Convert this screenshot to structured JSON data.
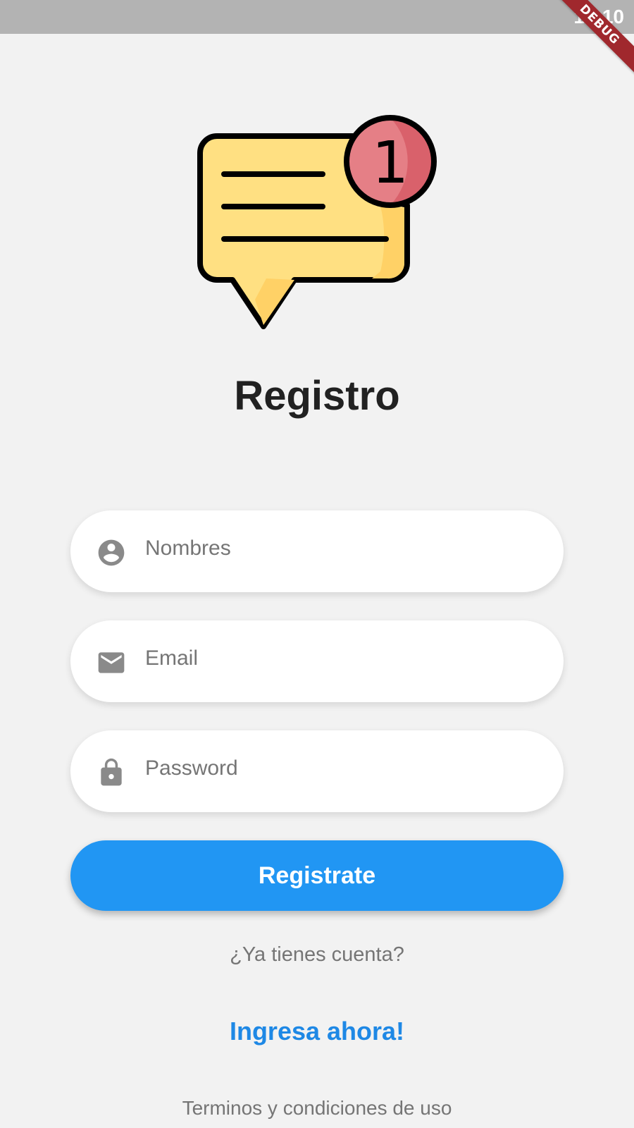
{
  "status_bar": {
    "time": "16:10",
    "debug_label": "DEBUG"
  },
  "header": {
    "title": "Registro",
    "logo_icon": "chat-notification-icon",
    "badge_count": "1"
  },
  "form": {
    "name_field": {
      "placeholder": "Nombres",
      "value": "",
      "icon": "account-circle-icon"
    },
    "email_field": {
      "placeholder": "Email",
      "value": "",
      "icon": "mail-icon"
    },
    "password_field": {
      "placeholder": "Password",
      "value": "",
      "icon": "lock-icon"
    },
    "submit_label": "Registrate"
  },
  "footer": {
    "have_account_text": "¿Ya tienes cuenta?",
    "login_link": "Ingresa ahora!",
    "terms_text": "Terminos y condiciones de uso"
  },
  "colors": {
    "primary": "#2196f3",
    "link": "#1e88e5",
    "background": "#f2f2f2",
    "bubble": "#ffe082",
    "badge": "#e57373"
  }
}
